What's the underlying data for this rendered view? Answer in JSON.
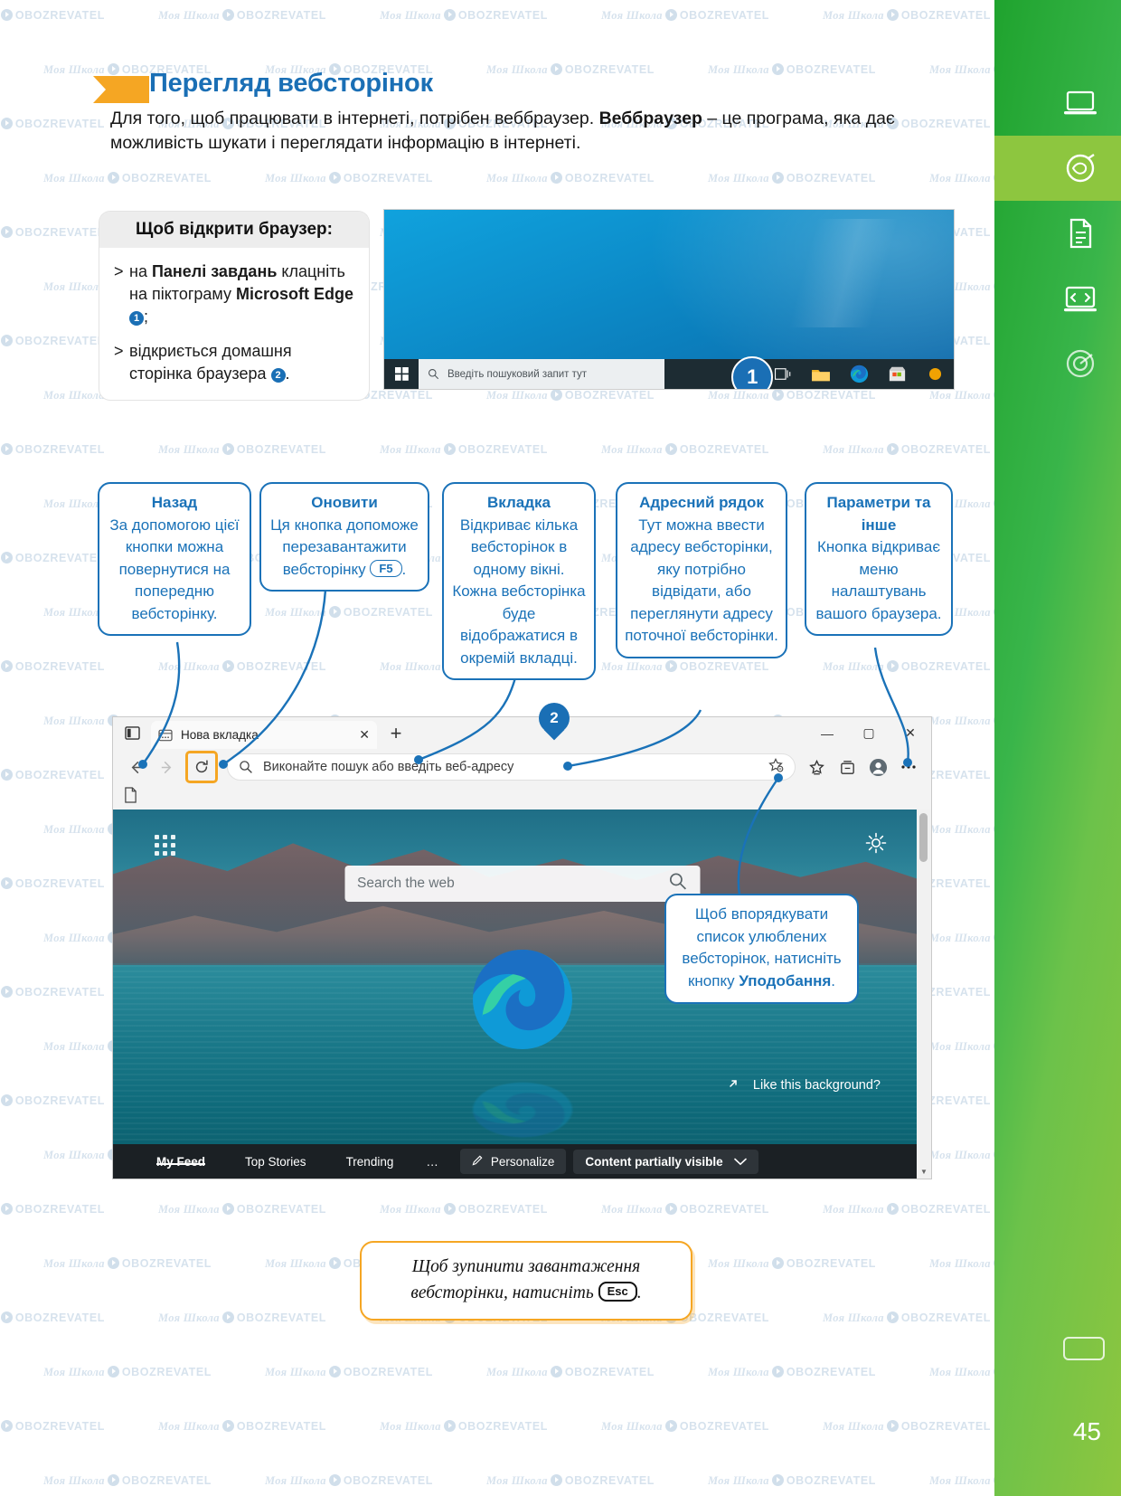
{
  "page": {
    "number": "45"
  },
  "header": {
    "title": "Перегляд вебсторінок",
    "intro_before": "Для того, щоб працювати в інтернеті, потрібен веббраузер. ",
    "intro_bold": "Веббраузер",
    "intro_after": " – це програма, яка дає можливість шукати і переглядати інформацію в інтернеті."
  },
  "card": {
    "heading": "Щоб відкрити браузер:",
    "items": [
      {
        "marker": ">",
        "before": "на ",
        "bold": "Панелі завдань",
        "mid": " клацніть на піктограму ",
        "bold2": "Microsoft Edge",
        "badge": "1",
        "after": ";"
      },
      {
        "marker": ">",
        "before": "відкриється домашня сторінка браузера ",
        "badge": "2",
        "after": "."
      }
    ]
  },
  "desktop_shot": {
    "pin_label": "1",
    "taskbar": {
      "start_icon": "windows-logo-icon",
      "search_placeholder": "Введіть пошуковий запит тут",
      "search_icon": "search-icon",
      "buttons": [
        "task-view-icon",
        "file-explorer-icon",
        "microsoft-edge-icon",
        "microsoft-store-icon",
        "notification-icon"
      ]
    }
  },
  "callouts": [
    {
      "title": "Назад",
      "text": "За допомогою цієї кнопки можна повернутися на попередню вебсторінку."
    },
    {
      "title": "Оновити",
      "text_before": "Ця кнопка допоможе перезавантажити вебсторінку ",
      "key": "F5",
      "text_after": "."
    },
    {
      "title": "Вкладка",
      "text": "Відкриває кілька вебсторінок в одному вікні. Кожна вебсторінка буде відображатися в окремій вкладці."
    },
    {
      "title": "Адресний рядок",
      "text": "Тут можна ввести адресу вебсторінки, яку потрібно відвідати, або переглянути адресу поточної вебсторінки."
    },
    {
      "title": "Параметри та інше",
      "text": "Кнопка відкриває меню налаштувань вашого браузера."
    }
  ],
  "browser": {
    "pin_label": "2",
    "tab": {
      "title": "Нова вкладка",
      "close_label": "✕",
      "new_tab_label": "+"
    },
    "tabs_icon": "tab-actions-icon",
    "window_controls": {
      "minimize": "—",
      "maximize": "▢",
      "close": "✕"
    },
    "nav": {
      "back_icon": "arrow-left-icon",
      "forward_icon": "arrow-right-icon",
      "reload_icon": "reload-icon",
      "search_icon": "search-icon",
      "omnibox_placeholder": "Виконайте пошук або введіть веб-адресу",
      "right_icons": [
        "favorite-star-icon",
        "favorites-hub-icon",
        "collections-icon",
        "profile-icon",
        "settings-more-icon"
      ]
    },
    "favorites_bar_icon": "document-icon",
    "content": {
      "waffle_icon": "app-launcher-icon",
      "gear_icon": "gear-icon",
      "search_placeholder": "Search the web",
      "search_icon": "search-icon",
      "like_background": "Like this background?",
      "like_background_icon": "expand-arrow-icon",
      "feed": {
        "items": [
          "My Feed",
          "Top Stories",
          "Trending"
        ],
        "more": "…",
        "personalize": "Personalize",
        "personalize_icon": "pencil-icon",
        "visibility": "Content partially visible",
        "visibility_icon": "chevron-down-icon"
      }
    },
    "favorites_callout": {
      "text_before": "Щоб впорядкувати список улюблених вебсторінок, натисніть кнопку ",
      "bold": "Уподобання",
      "text_after": "."
    }
  },
  "note": {
    "text_before": "Щоб зупинити завантаження вебсторінки, натисніть ",
    "key": "Esc",
    "text_after": "."
  },
  "rail": {
    "items": [
      {
        "icon": "laptop-icon",
        "active": false
      },
      {
        "icon": "brain-gear-icon",
        "active": true
      },
      {
        "icon": "document-lines-icon",
        "active": false
      },
      {
        "icon": "code-screen-icon",
        "active": false
      },
      {
        "icon": "target-pie-icon",
        "active": false
      }
    ]
  },
  "watermark": {
    "brand": "Моя Школа",
    "site": "OBOZREVATEL"
  },
  "colors": {
    "accent_blue": "#1a6fb5",
    "callout_blue": "#1a72b8",
    "orange": "#f5a623",
    "rail_green_dark": "#1fa32e",
    "rail_green_light": "#8dc63f"
  }
}
